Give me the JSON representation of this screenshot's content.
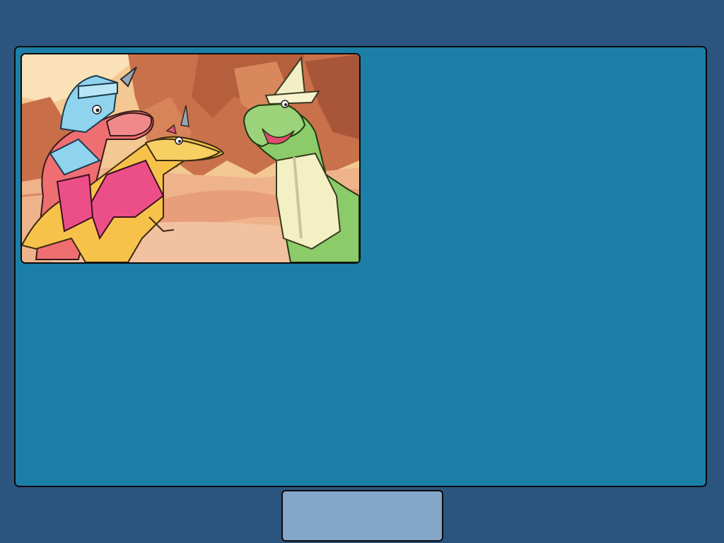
{
  "scene": {
    "characters": [
      "knight-dinosaur",
      "unicorn-dinosaur",
      "wizard-dinosaur"
    ],
    "setting": "desert-canyon"
  },
  "footer": {
    "continue_label": ""
  },
  "colors": {
    "background": "#2b557f",
    "panel": "#1b7fa8",
    "button": "#84a6c9",
    "border": "#0b0b0b"
  }
}
